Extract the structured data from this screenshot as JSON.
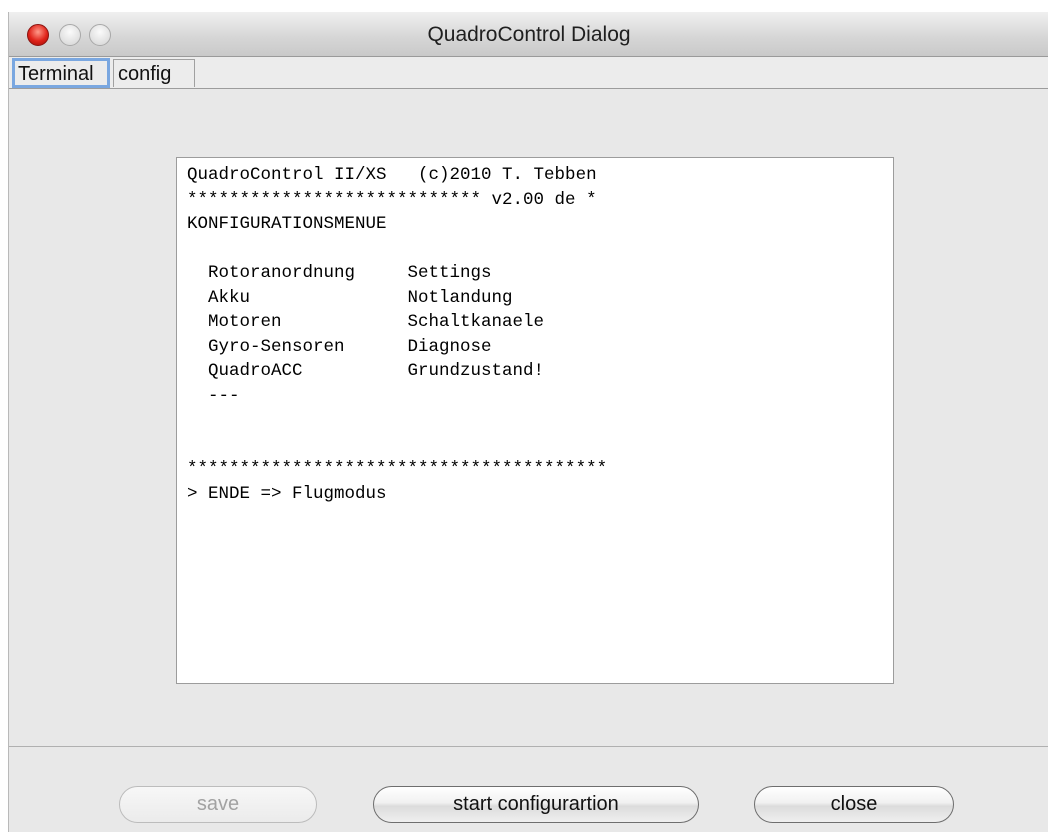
{
  "window": {
    "title": "QuadroControl Dialog"
  },
  "tabs": [
    {
      "label": "Terminal",
      "active": true
    },
    {
      "label": "config",
      "active": false
    }
  ],
  "terminal": {
    "lines": [
      "QuadroControl II/XS   (c)2010 T. Tebben",
      "**************************** v2.00 de *",
      "KONFIGURATIONSMENUE",
      "",
      "  Rotoranordnung     Settings",
      "  Akku               Notlandung",
      "  Motoren            Schaltkanaele",
      "  Gyro-Sensoren      Diagnose",
      "  QuadroACC          Grundzustand!",
      "  ---",
      "",
      "",
      "****************************************",
      "> ENDE => Flugmodus"
    ]
  },
  "buttons": {
    "save": {
      "label": "save",
      "enabled": false
    },
    "start": {
      "label": "start configurartion",
      "enabled": true
    },
    "close": {
      "label": "close",
      "enabled": true
    }
  },
  "colors": {
    "close_dot": "#e0231a",
    "focus_ring": "#7aa7e0",
    "window_bg": "#e8e8e8"
  }
}
